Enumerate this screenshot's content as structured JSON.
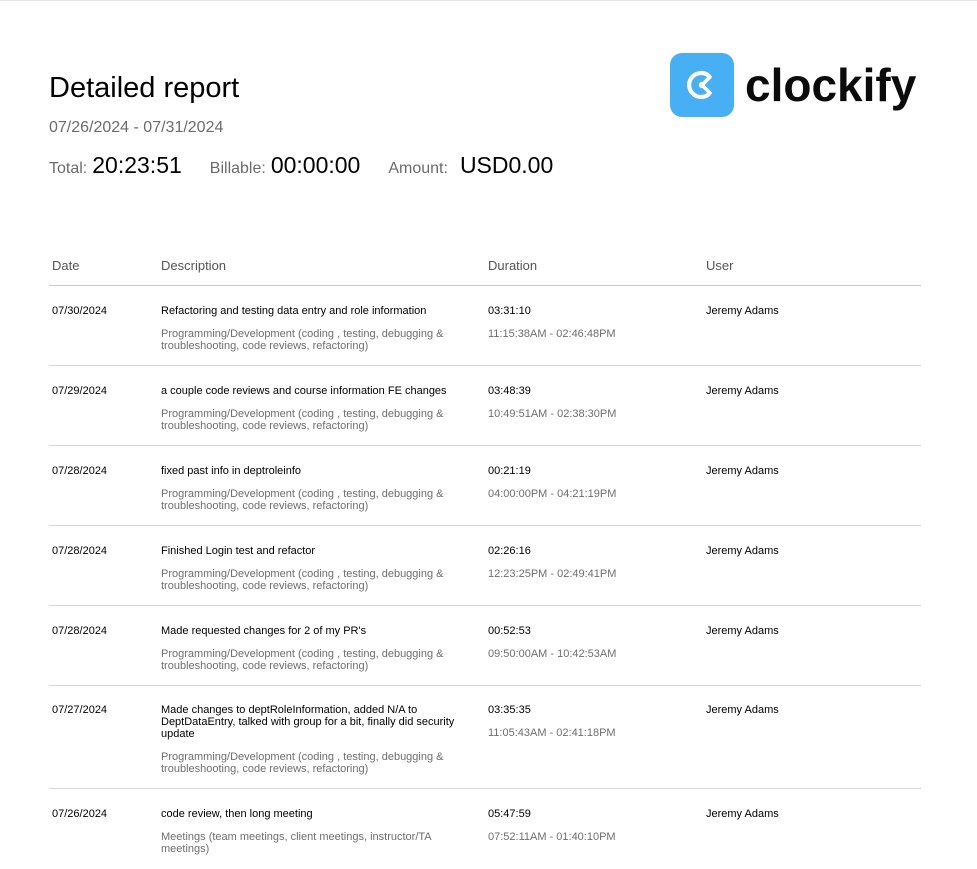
{
  "report": {
    "title": "Detailed report",
    "date_range": "07/26/2024 - 07/31/2024",
    "totals": {
      "total_label": "Total:",
      "total_value": "20:23:51",
      "billable_label": "Billable:",
      "billable_value": "00:00:00",
      "amount_label": "Amount:",
      "amount_value": "USD0.00"
    }
  },
  "logo": {
    "text": "clockify",
    "icon": "clockify-logo-icon",
    "brand_color": "#47b0f5"
  },
  "table": {
    "headers": {
      "date": "Date",
      "description": "Description",
      "duration": "Duration",
      "user": "User"
    },
    "rows": [
      {
        "date": "07/30/2024",
        "description": "Refactoring and testing data entry and role information",
        "project": "Programming/Development (coding , testing, debugging & troubleshooting, code reviews, refactoring)",
        "duration": "03:31:10",
        "time_range": "11:15:38AM - 02:46:48PM",
        "user": "Jeremy Adams"
      },
      {
        "date": "07/29/2024",
        "description": "a couple code reviews and course information FE changes",
        "project": "Programming/Development (coding , testing, debugging & troubleshooting, code reviews, refactoring)",
        "duration": "03:48:39",
        "time_range": "10:49:51AM - 02:38:30PM",
        "user": "Jeremy Adams"
      },
      {
        "date": "07/28/2024",
        "description": "fixed past info in deptroleinfo",
        "project": "Programming/Development (coding , testing, debugging & troubleshooting, code reviews, refactoring)",
        "duration": "00:21:19",
        "time_range": "04:00:00PM - 04:21:19PM",
        "user": "Jeremy Adams"
      },
      {
        "date": "07/28/2024",
        "description": "Finished Login test and refactor",
        "project": "Programming/Development (coding , testing, debugging & troubleshooting, code reviews, refactoring)",
        "duration": "02:26:16",
        "time_range": "12:23:25PM - 02:49:41PM",
        "user": "Jeremy Adams"
      },
      {
        "date": "07/28/2024",
        "description": "Made requested changes for 2 of my PR's",
        "project": "Programming/Development (coding , testing, debugging & troubleshooting, code reviews, refactoring)",
        "duration": "00:52:53",
        "time_range": "09:50:00AM - 10:42:53AM",
        "user": "Jeremy Adams"
      },
      {
        "date": "07/27/2024",
        "description": "Made changes to deptRoleInformation, added N/A to DeptDataEntry, talked with group for a bit, finally did security update",
        "project": "Programming/Development (coding , testing, debugging & troubleshooting, code reviews, refactoring)",
        "duration": "03:35:35",
        "time_range": "11:05:43AM - 02:41:18PM",
        "user": "Jeremy Adams"
      },
      {
        "date": "07/26/2024",
        "description": "code review, then long meeting",
        "project": "Meetings (team meetings, client meetings, instructor/TA meetings)",
        "duration": "05:47:59",
        "time_range": "07:52:11AM - 01:40:10PM",
        "user": "Jeremy Adams"
      }
    ]
  }
}
